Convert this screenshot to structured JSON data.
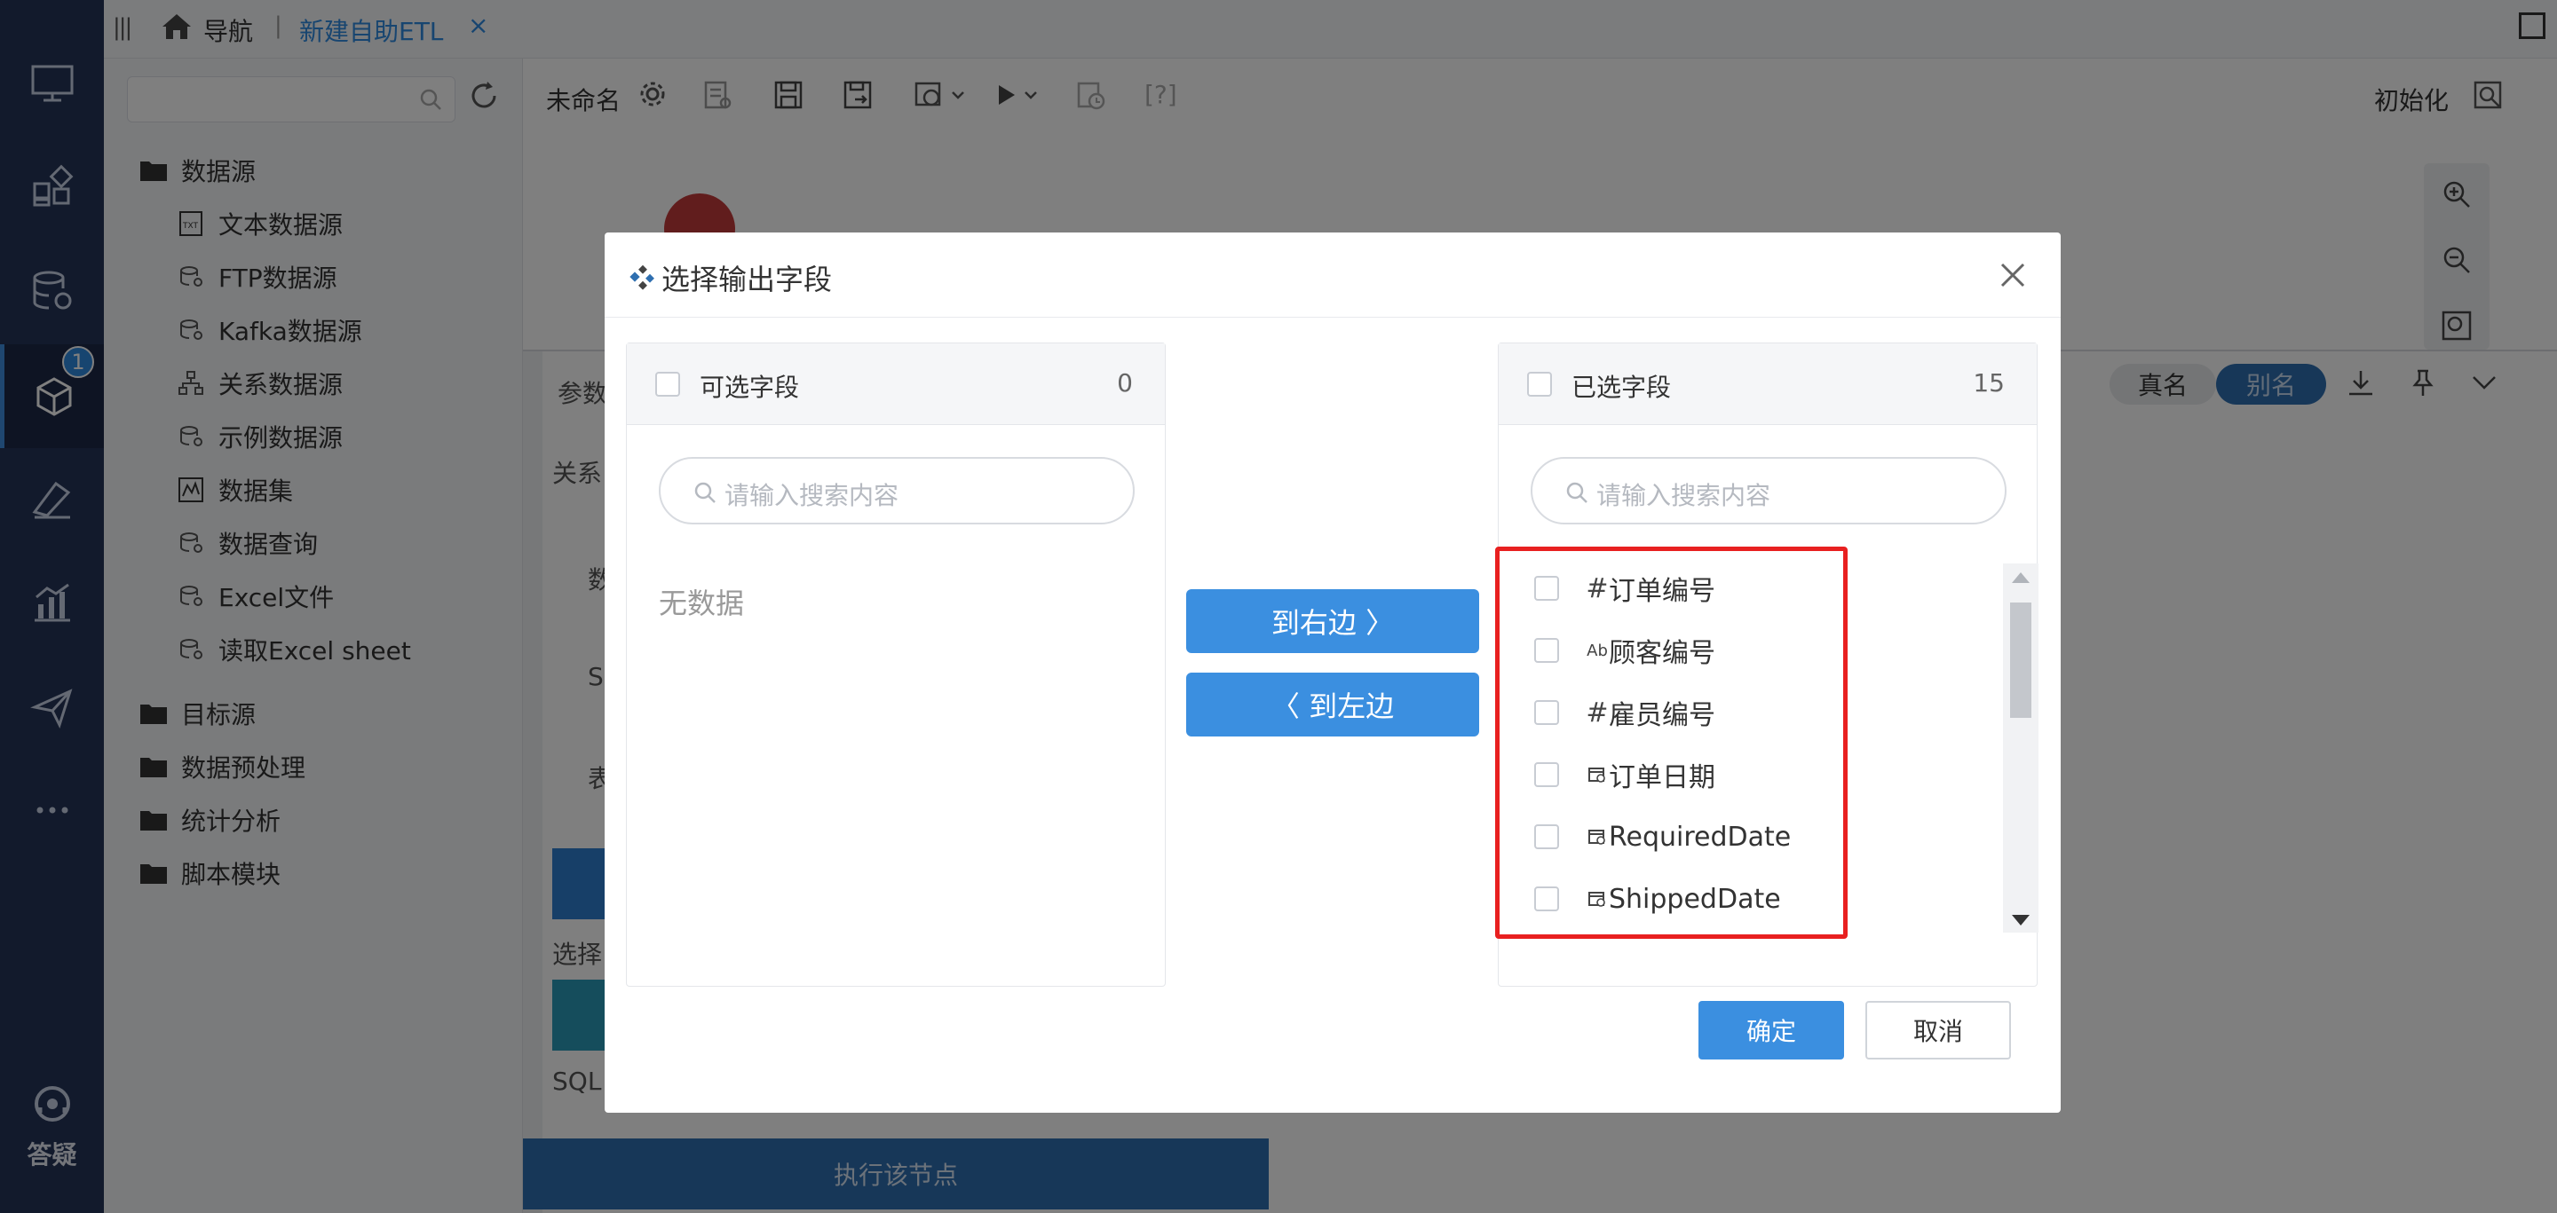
{
  "topbar": {
    "nav_label": "导航",
    "separator": "|",
    "active_tab": "新建自助ETL",
    "close_glyph": "×"
  },
  "rail": {
    "badge_count": "1",
    "help_label": "答疑",
    "items": [
      "monitor-icon",
      "widgets-icon",
      "database-settings-icon",
      "cube-icon",
      "ruler-icon",
      "chart-icon",
      "send-icon",
      "more-icon"
    ]
  },
  "tree": {
    "search_placeholder": "",
    "nodes": [
      {
        "label": "数据源",
        "icon": "folder-open-icon"
      },
      {
        "label": "文本数据源",
        "icon": "txt-file-icon"
      },
      {
        "label": "FTP数据源",
        "icon": "db-icon"
      },
      {
        "label": "Kafka数据源",
        "icon": "db-icon"
      },
      {
        "label": "关系数据源",
        "icon": "relation-icon"
      },
      {
        "label": "示例数据源",
        "icon": "db-icon"
      },
      {
        "label": "数据集",
        "icon": "dataset-icon"
      },
      {
        "label": "数据查询",
        "icon": "db-icon"
      },
      {
        "label": "Excel文件",
        "icon": "db-icon"
      },
      {
        "label": "读取Excel sheet",
        "icon": "db-icon"
      },
      {
        "label": "目标源",
        "icon": "folder-icon"
      },
      {
        "label": "数据预处理",
        "icon": "folder-icon"
      },
      {
        "label": "统计分析",
        "icon": "folder-icon"
      },
      {
        "label": "脚本模块",
        "icon": "folder-icon"
      }
    ]
  },
  "toolbar": {
    "title": "未命名",
    "help": "[?]",
    "init_label": "初始化"
  },
  "props": {
    "params_tab": "参数",
    "relation_label": "关系",
    "row1": "数",
    "row2": "S",
    "row3": "表",
    "select_label": "选择",
    "sql_label": "SQL",
    "exec_button": "执行该节点",
    "real_name": "真名",
    "alias": "别名"
  },
  "dialog": {
    "title": "选择输出字段",
    "left_panel": {
      "title": "可选字段",
      "count": "0",
      "search_placeholder": "请输入搜索内容",
      "empty_text": "无数据"
    },
    "right_panel": {
      "title": "已选字段",
      "count": "15",
      "search_placeholder": "请输入搜索内容",
      "fields": [
        {
          "type_glyph": "#",
          "name": "订单编号"
        },
        {
          "type_glyph": "Ab",
          "name": "顾客编号"
        },
        {
          "type_glyph": "#",
          "name": "雇员编号"
        },
        {
          "type_glyph": "date-icon",
          "name": "订单日期"
        },
        {
          "type_glyph": "date-icon",
          "name": "RequiredDate"
        },
        {
          "type_glyph": "date-icon",
          "name": "ShippedDate"
        }
      ]
    },
    "to_right": "到右边 〉",
    "to_left": "〈 到左边",
    "ok": "确定",
    "cancel": "取消"
  },
  "colors": {
    "rail_bg": "#253459",
    "accent": "#3b8fe0",
    "highlight": "#e82020"
  }
}
